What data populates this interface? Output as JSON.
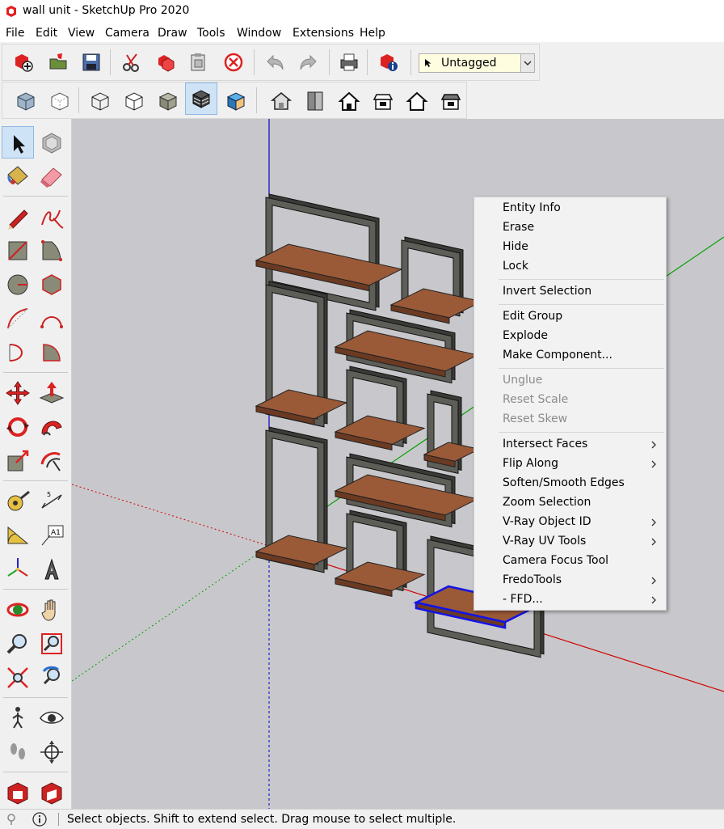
{
  "window": {
    "title": "wall unit - SketchUp Pro 2020"
  },
  "menubar": [
    "File",
    "Edit",
    "View",
    "Camera",
    "Draw",
    "Tools",
    "Window",
    "Extensions",
    "Help"
  ],
  "tag_selector": {
    "value": "Untagged"
  },
  "context_menu": {
    "items": [
      {
        "label": "Entity Info",
        "enabled": true,
        "submenu": false
      },
      {
        "label": "Erase",
        "enabled": true,
        "submenu": false
      },
      {
        "label": "Hide",
        "enabled": true,
        "submenu": false
      },
      {
        "label": "Lock",
        "enabled": true,
        "submenu": false
      },
      {
        "label": "Invert Selection",
        "enabled": true,
        "submenu": false
      },
      {
        "label": "Edit Group",
        "enabled": true,
        "submenu": false
      },
      {
        "label": "Explode",
        "enabled": true,
        "submenu": false
      },
      {
        "label": "Make Component...",
        "enabled": true,
        "submenu": false
      },
      {
        "label": "Unglue",
        "enabled": false,
        "submenu": false
      },
      {
        "label": "Reset Scale",
        "enabled": false,
        "submenu": false
      },
      {
        "label": "Reset Skew",
        "enabled": false,
        "submenu": false
      },
      {
        "label": "Intersect Faces",
        "enabled": true,
        "submenu": true
      },
      {
        "label": "Flip Along",
        "enabled": true,
        "submenu": true
      },
      {
        "label": "Soften/Smooth Edges",
        "enabled": true,
        "submenu": false
      },
      {
        "label": "Zoom Selection",
        "enabled": true,
        "submenu": false
      },
      {
        "label": "V-Ray Object ID",
        "enabled": true,
        "submenu": true
      },
      {
        "label": "V-Ray UV Tools",
        "enabled": true,
        "submenu": true
      },
      {
        "label": "Camera Focus Tool",
        "enabled": true,
        "submenu": false
      },
      {
        "label": "FredoTools",
        "enabled": true,
        "submenu": true
      },
      {
        "label": "- FFD...",
        "enabled": true,
        "submenu": true
      }
    ]
  },
  "statusbar": {
    "text": "Select objects. Shift to extend select. Drag mouse to select multiple."
  },
  "colors": {
    "viewport_bg": "#c8c8cc",
    "frame_fill": "#5e5e58",
    "shelf_top": "#9a5a38",
    "shelf_front": "#6b3a22",
    "selection": "#1414e6",
    "axis_red": "#d00000",
    "axis_green": "#00a000",
    "axis_blue": "#0000c8"
  }
}
